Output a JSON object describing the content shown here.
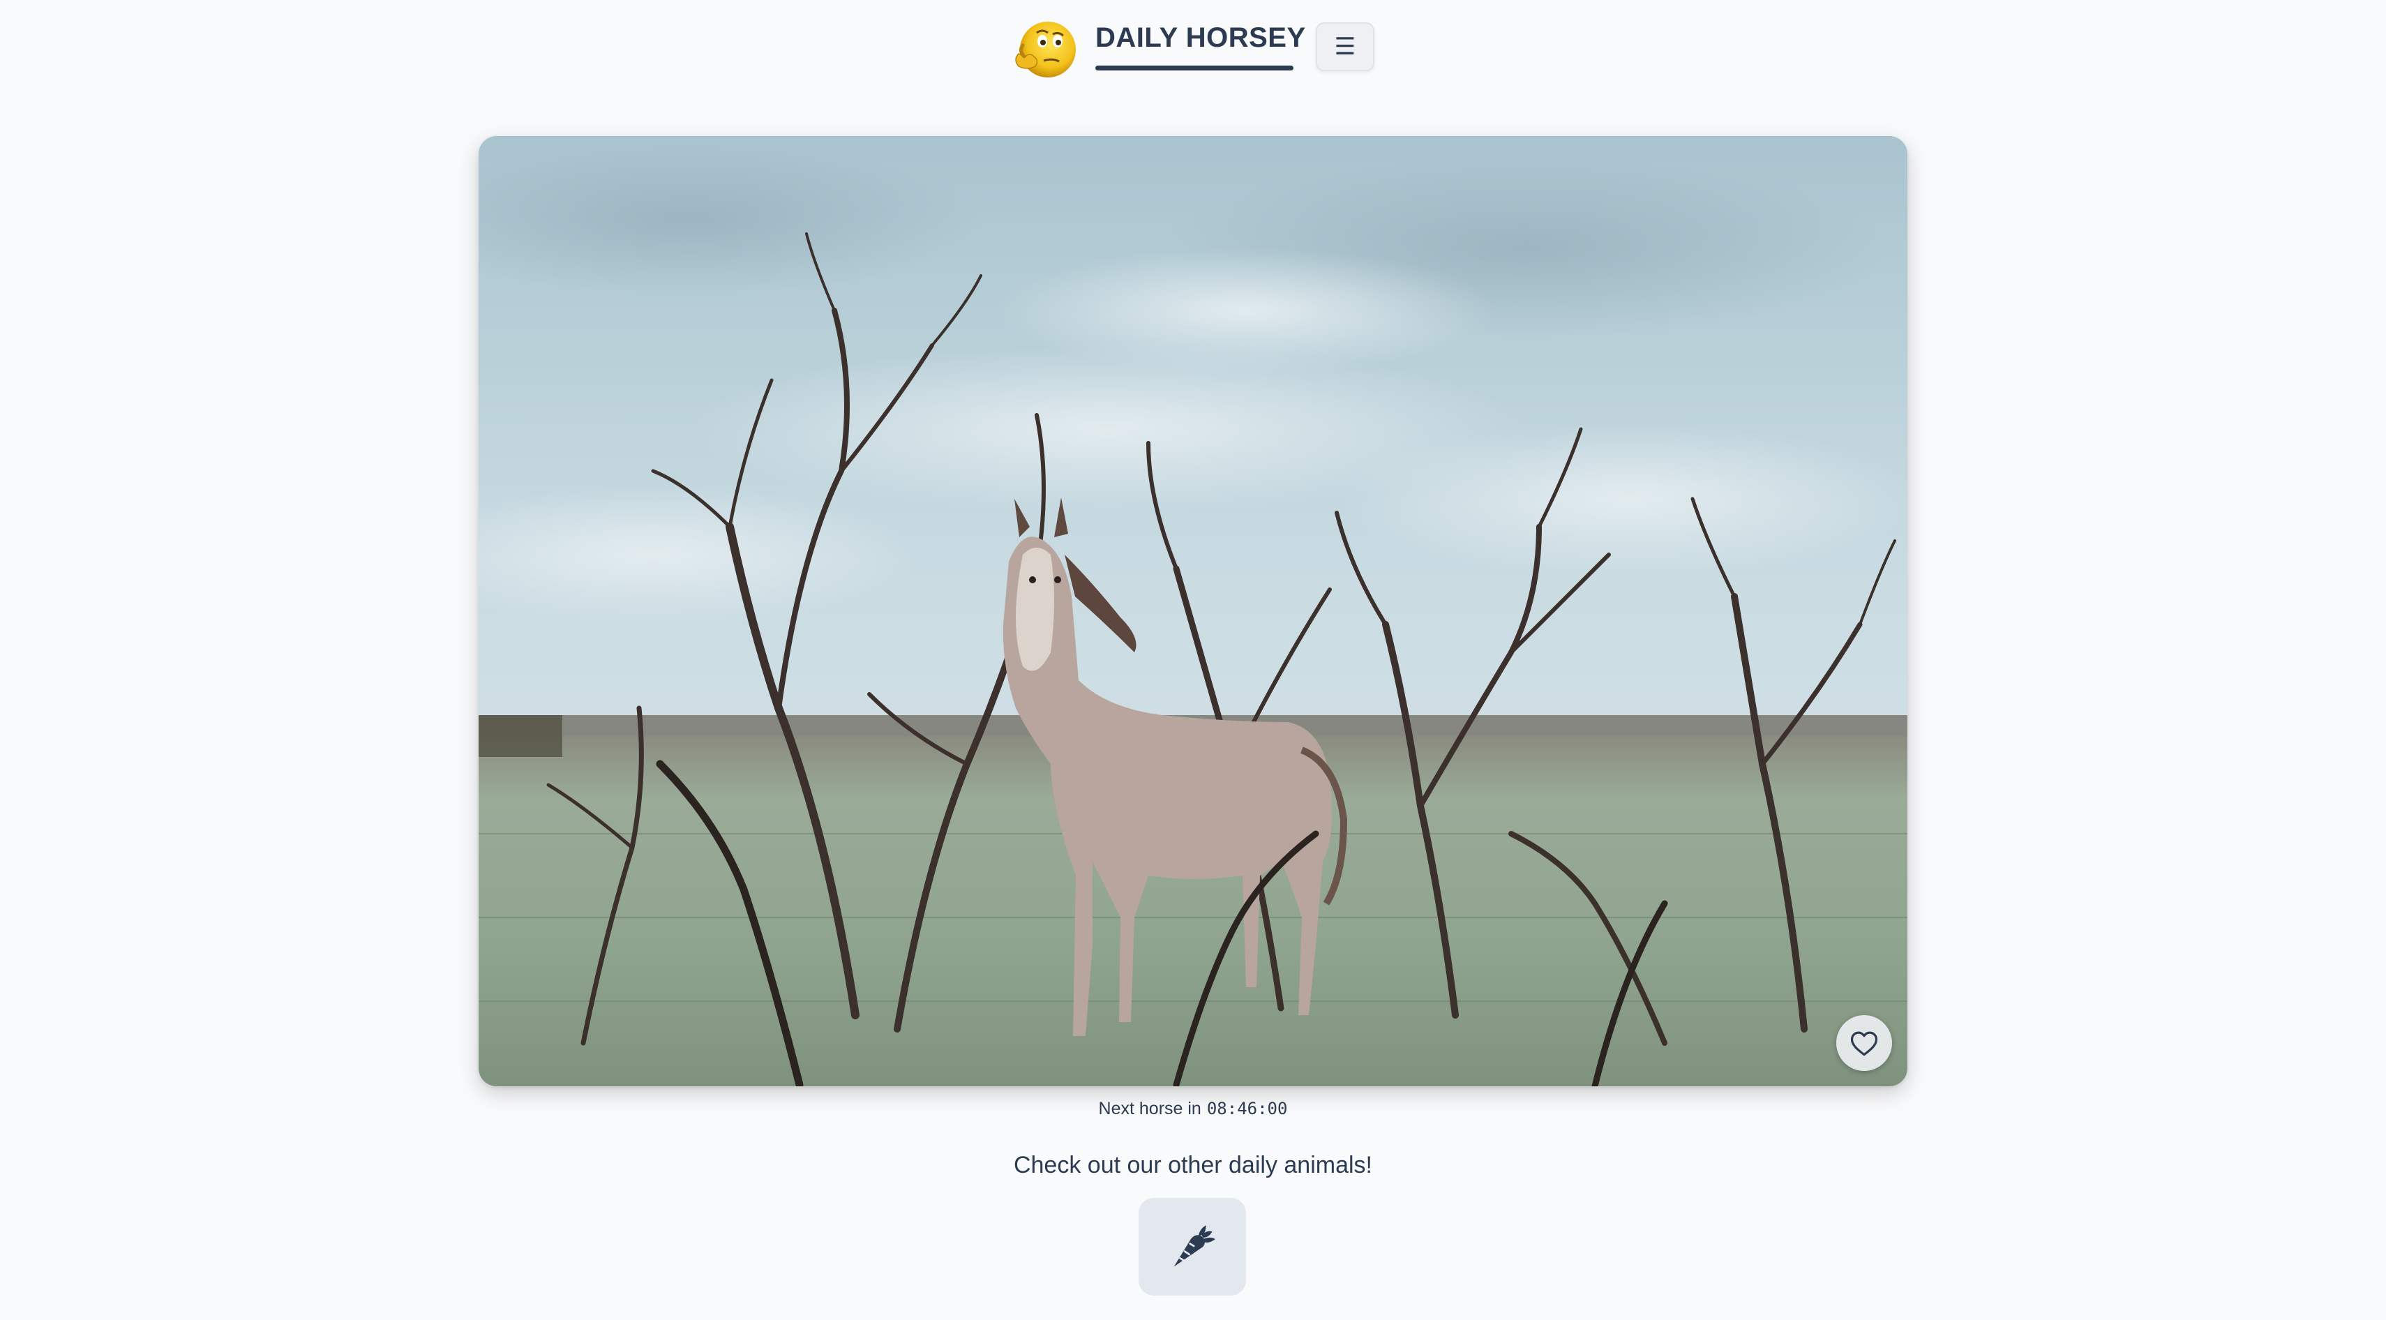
{
  "header": {
    "brand": "DAILY HORSEY",
    "logo_icon": "thinking-emoji-icon",
    "menu_glyph": "☰",
    "menu_icon": "hamburger-menu-icon"
  },
  "photo": {
    "subject": "horse-foal-photo",
    "favorite_icon": "heart-icon"
  },
  "countdown": {
    "label": "Next horse in",
    "time": "08:46:00"
  },
  "other_animals": {
    "title": "Check out our other daily animals!",
    "links": [
      {
        "icon": "carrot-icon"
      }
    ]
  },
  "colors": {
    "background": "#f9fafb",
    "text": "#2c3a52",
    "button_bg": "#e3e8ef",
    "accent": "#2c3a52"
  }
}
